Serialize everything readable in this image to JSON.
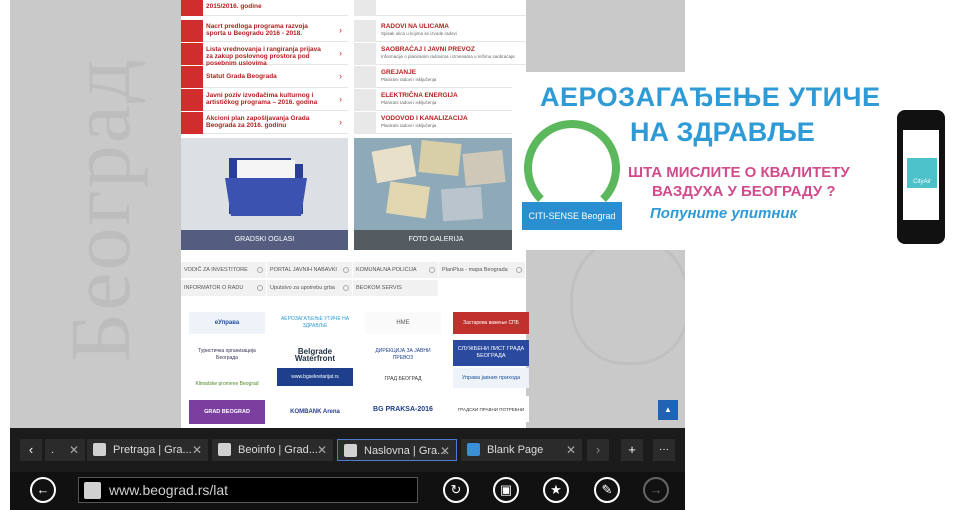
{
  "watermark": "Београд",
  "links_left": [
    "2015/2016. godine",
    "Nacrt predloga programa razvoja sporta u Beogradu 2016 - 2018.",
    "Lista vrednovanja i rangiranja prijava za zakup poslovnog prostora pod posebnim uslovima",
    "Statut Grada Beograda",
    "Javni poziv izvođačima kulturnog i artističkog programa – 2016. godina",
    "Akcioni plan zapošljavanja Grada Beograda za 2016. godinu"
  ],
  "links_right": [
    {
      "title": "",
      "sub": ""
    },
    {
      "title": "RADOVI NA ULICAMA",
      "sub": "Spisak ulica u kojima se izvode radovi"
    },
    {
      "title": "SAOBRAĆAJ I JAVNI PREVOZ",
      "sub": "Informacije o planiranim radovima i izmenama u režimu saobraćaja"
    },
    {
      "title": "GREJANJE",
      "sub": "Planirani radovi i isključenja"
    },
    {
      "title": "ELEKTRIČNA ENERGIJA",
      "sub": "Planirani radovi i isključenja"
    },
    {
      "title": "VODOVOD I KANALIZACIJA",
      "sub": "Planirani radovi i isključenja"
    }
  ],
  "tiles": {
    "oglasi": "GRADSKI OGLASI",
    "galerija": "FOTO GALERIJA"
  },
  "quick_links": [
    "VODIČ ZA INVESTITORE",
    "PORTAL JAVNIH NABAVKI",
    "KOMUNALNA POLICIJA",
    "PlanPlus - mapa Beograda",
    "INFORMATOR O RADU",
    "Uputstvo za upotrebu grba",
    "BEOKOM SERVIS"
  ],
  "logos": [
    "еУправа",
    "АЕРОЗАГАЂЕЊЕ УТИЧЕ НА ЗДРАВЉЕ",
    "HME",
    "Застарева важење СПБ",
    "Туристичка организација Београда",
    "Belgrade Waterfront",
    "ДИРЕКЦИЈА ЗА ЈАВНИ ПРЕВОЗ",
    "СЛУЖБЕНИ ЛИСТ ГРАДА БЕОГРАДА",
    "Klimatske promene Beograd",
    "www.bgsekretarijat.rs",
    "ГРАД БЕОГРАД",
    "Управа јавних прихода",
    "GRAD BEOGRAD",
    "KOMBANK Arena",
    "BG PRAKSA-2016",
    "ГРАДСКИ ПРАВНИ ПОТРЕБНИ"
  ],
  "ad": {
    "line1": "АЕРОЗАГАЂЕЊЕ УТИЧЕ",
    "line2": "НА ЗДРАВЉЕ",
    "line3": "ШТА МИСЛИТЕ О КВАЛИТЕТУ",
    "line4": "ВАЗДУХА У БЕОГРАДУ ?",
    "line5": "Попуните упитник",
    "citi": "CITI-SENSE Beograd",
    "cityair": "CityAir"
  },
  "tabs": [
    {
      "label": ".",
      "active": false
    },
    {
      "label": "Pretraga | Gra...",
      "active": false
    },
    {
      "label": "Beoinfo | Grad...",
      "active": false
    },
    {
      "label": "Naslovna | Gra...",
      "active": true
    },
    {
      "label": "Blank Page",
      "active": false
    }
  ],
  "address": {
    "url": "www.beograd.rs/lat"
  }
}
